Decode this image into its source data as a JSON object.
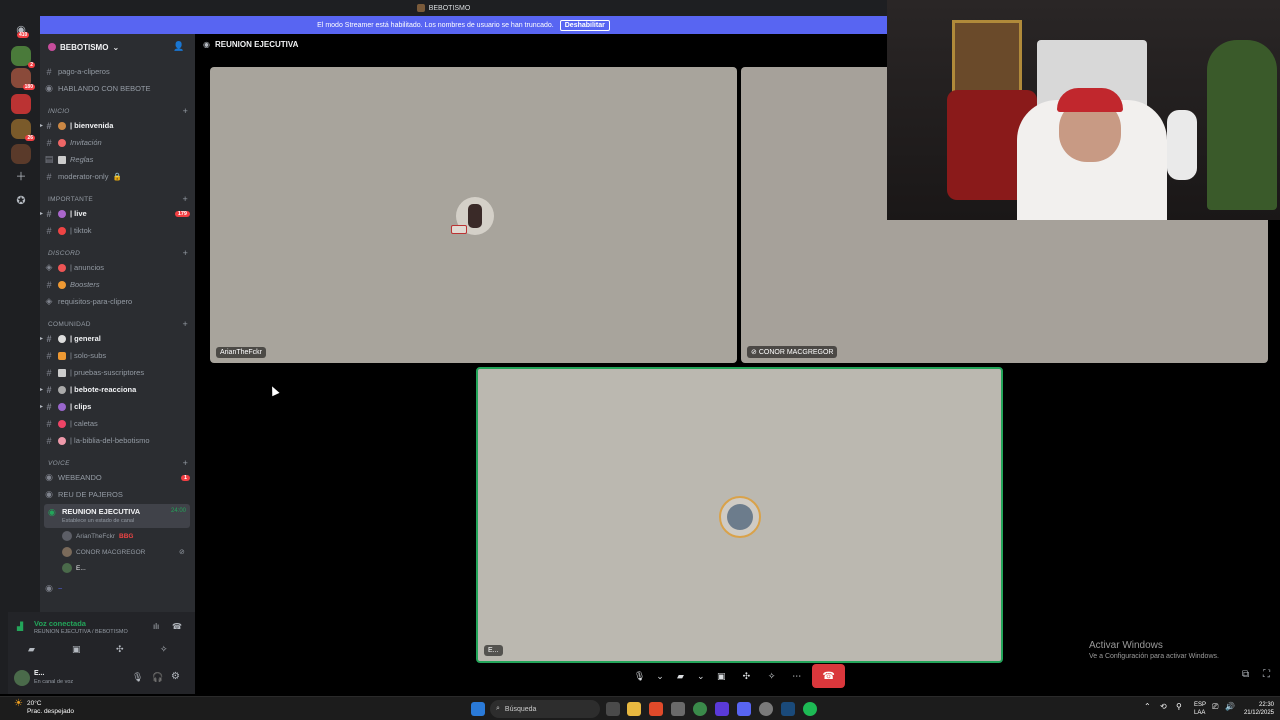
{
  "titlebar": {
    "title": "BEBOTISMO"
  },
  "banner": {
    "text": "El modo Streamer está habilitado. Los nombres de usuario se han truncado.",
    "button": "Deshabilitar"
  },
  "rail": {
    "badges": [
      "410",
      "2",
      "180",
      "26"
    ]
  },
  "server": {
    "name": "BEBOTISMO"
  },
  "channels": {
    "top": [
      {
        "name": "pago-a-cliperos"
      },
      {
        "name": "HABLANDO CON BEBOTE"
      }
    ],
    "cat_inicio": "INICIO",
    "inicio": [
      {
        "name": "| bienvenida"
      },
      {
        "name": "Invitación"
      },
      {
        "name": "Reglas"
      },
      {
        "name": "moderator-only"
      }
    ],
    "cat_importante": "IMPORTANTE",
    "importante": [
      {
        "name": "| live",
        "badge": "179"
      },
      {
        "name": "| tiktok"
      }
    ],
    "cat_discord": "DISCORD",
    "discord": [
      {
        "name": "| anuncios"
      },
      {
        "name": "Boosters"
      },
      {
        "name": "requisitos-para-clipero"
      }
    ],
    "cat_comunidad": "COMUNIDAD",
    "comunidad": [
      {
        "name": "| general"
      },
      {
        "name": "| solo-subs"
      },
      {
        "name": "| pruebas-suscriptores"
      },
      {
        "name": "| bebote-reacciona"
      },
      {
        "name": "| clips"
      },
      {
        "name": "| caletas"
      },
      {
        "name": "| la-biblia-del-bebotismo"
      }
    ],
    "cat_voice": "VOICE",
    "voice": [
      {
        "name": "WEBEANDO",
        "badge": "1"
      },
      {
        "name": "REU DE PAJEROS"
      },
      {
        "name": "REUNION EJECUTIVA",
        "time": "24:00",
        "status": "Establece un estado de canal"
      }
    ],
    "voice_users": [
      {
        "name": "ArianTheFckr",
        "tag": "BBG"
      },
      {
        "name": "CONOR MACGREGOR"
      },
      {
        "name": "E..."
      }
    ]
  },
  "voice_panel": {
    "status": "Voz conectada",
    "location": "REUNION EJECUTIVA / BEBOTISMO"
  },
  "user_panel": {
    "name": "E...",
    "status": "En canal de voz"
  },
  "main": {
    "channel_title": "REUNION EJECUTIVA",
    "tiles": [
      {
        "label": "ArianTheFckr"
      },
      {
        "label": "CONOR MACGREGOR"
      },
      {
        "label": "E..."
      }
    ]
  },
  "watermark": {
    "line1": "Activar Windows",
    "line2": "Ve a Configuración para activar Windows."
  },
  "taskbar": {
    "temp": "20°C",
    "weather": "Prac. despejado",
    "search_placeholder": "Búsqueda",
    "lang1": "ESP",
    "lang2": "LAA",
    "time": "22:30",
    "date": "21/12/2025"
  },
  "colors": {
    "accent": "#5865f2",
    "danger": "#da373c",
    "green": "#23a55a",
    "sidebar": "#2b2d31"
  }
}
